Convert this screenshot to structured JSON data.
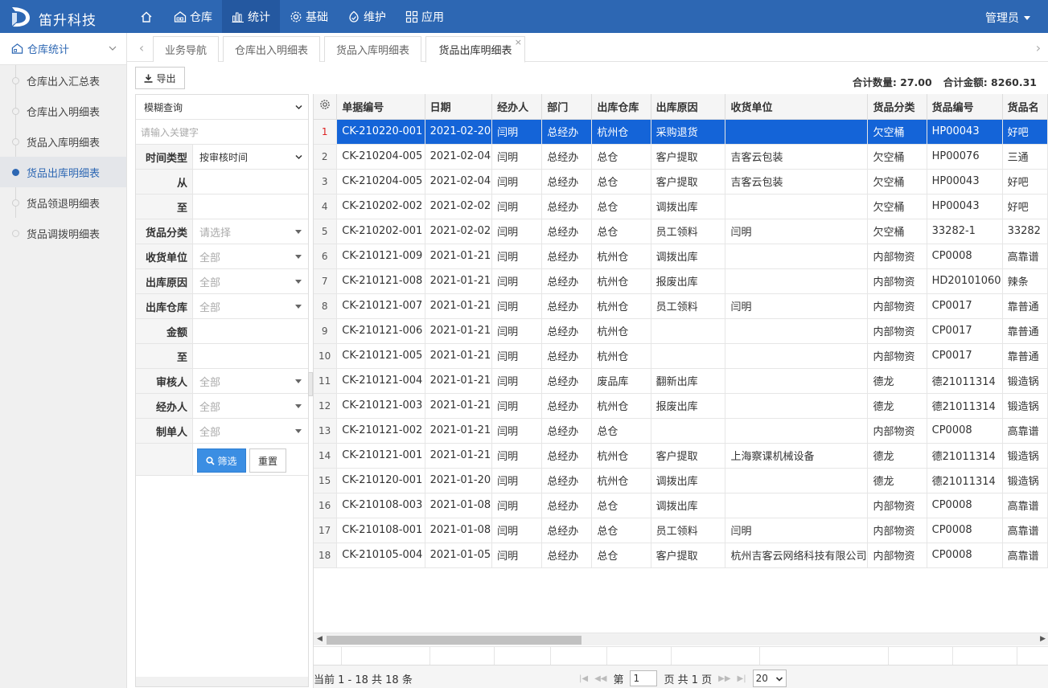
{
  "app": {
    "brand": "笛升科技",
    "user": "管理员"
  },
  "nav": [
    {
      "label": "",
      "icon": "home-icon"
    },
    {
      "label": "仓库",
      "icon": "warehouse-icon"
    },
    {
      "label": "统计",
      "icon": "chart-icon"
    },
    {
      "label": "基础",
      "icon": "gear-icon"
    },
    {
      "label": "维护",
      "icon": "maintenance-icon"
    },
    {
      "label": "应用",
      "icon": "apps-icon"
    }
  ],
  "sidebar": {
    "header": "仓库统计",
    "items": [
      "仓库出入汇总表",
      "仓库出入明细表",
      "货品入库明细表",
      "货品出库明细表",
      "货品领退明细表",
      "货品调拨明细表"
    ],
    "active_index": 3
  },
  "tabs": [
    "业务导航",
    "仓库出入明细表",
    "货品入库明细表",
    "货品出库明细表"
  ],
  "toolbar": {
    "export_label": "导出",
    "total_qty": "合计数量: 27.00",
    "total_amount": "合计金额: 8260.31"
  },
  "filter": {
    "search_mode": "模糊查询",
    "keyword_placeholder": "请输入关键字",
    "time_type_label": "时间类型",
    "time_type_value": "按审核时间",
    "from_label": "从",
    "to_label": "至",
    "category_label": "货品分类",
    "category_value": "请选择",
    "receiver_label": "收货单位",
    "receiver_value": "全部",
    "reason_label": "出库原因",
    "reason_value": "全部",
    "warehouse_label": "出库仓库",
    "warehouse_value": "全部",
    "amount_label": "金额",
    "amount_to_label": "至",
    "auditor_label": "审核人",
    "auditor_value": "全部",
    "handler_label": "经办人",
    "handler_value": "全部",
    "maker_label": "制单人",
    "maker_value": "全部",
    "filter_button": "筛选",
    "reset_button": "重置"
  },
  "table": {
    "columns": [
      "单据编号",
      "日期",
      "经办人",
      "部门",
      "出库仓库",
      "出库原因",
      "收货单位",
      "货品分类",
      "货品编号",
      "货品名"
    ],
    "rows": [
      [
        "CK-210220-001",
        "2021-02-20",
        "闫明",
        "总经办",
        "杭州仓",
        "采购退货",
        "",
        "欠空桶",
        "HP00043",
        "好吧"
      ],
      [
        "CK-210204-005",
        "2021-02-04",
        "闫明",
        "总经办",
        "总仓",
        "客户提取",
        "吉客云包装",
        "欠空桶",
        "HP00076",
        "三通"
      ],
      [
        "CK-210204-005",
        "2021-02-04",
        "闫明",
        "总经办",
        "总仓",
        "客户提取",
        "吉客云包装",
        "欠空桶",
        "HP00043",
        "好吧"
      ],
      [
        "CK-210202-002",
        "2021-02-02",
        "闫明",
        "总经办",
        "总仓",
        "调拨出库",
        "",
        "欠空桶",
        "HP00043",
        "好吧"
      ],
      [
        "CK-210202-001",
        "2021-02-02",
        "闫明",
        "总经办",
        "总仓",
        "员工领料",
        "闫明",
        "欠空桶",
        "33282-1",
        "33282"
      ],
      [
        "CK-210121-009",
        "2021-01-21",
        "闫明",
        "总经办",
        "杭州仓",
        "调拨出库",
        "",
        "内部物资",
        "CP0008",
        "高靠谱"
      ],
      [
        "CK-210121-008",
        "2021-01-21",
        "闫明",
        "总经办",
        "杭州仓",
        "报废出库",
        "",
        "内部物资",
        "HD20101060",
        "辣条"
      ],
      [
        "CK-210121-007",
        "2021-01-21",
        "闫明",
        "总经办",
        "杭州仓",
        "员工领料",
        "闫明",
        "内部物资",
        "CP0017",
        "靠普通"
      ],
      [
        "CK-210121-006",
        "2021-01-21",
        "闫明",
        "总经办",
        "杭州仓",
        "",
        "",
        "内部物资",
        "CP0017",
        "靠普通"
      ],
      [
        "CK-210121-005",
        "2021-01-21",
        "闫明",
        "总经办",
        "杭州仓",
        "",
        "",
        "内部物资",
        "CP0017",
        "靠普通"
      ],
      [
        "CK-210121-004",
        "2021-01-21",
        "闫明",
        "总经办",
        "废品库",
        "翻新出库",
        "",
        "德龙",
        "德21011314",
        "锻造锅"
      ],
      [
        "CK-210121-003",
        "2021-01-21",
        "闫明",
        "总经办",
        "杭州仓",
        "报废出库",
        "",
        "德龙",
        "德21011314",
        "锻造锅"
      ],
      [
        "CK-210121-002",
        "2021-01-21",
        "闫明",
        "总经办",
        "总仓",
        "",
        "",
        "内部物资",
        "CP0008",
        "高靠谱"
      ],
      [
        "CK-210121-001",
        "2021-01-21",
        "闫明",
        "总经办",
        "杭州仓",
        "客户提取",
        "上海察课机械设备",
        "德龙",
        "德21011314",
        "锻造锅"
      ],
      [
        "CK-210120-001",
        "2021-01-20",
        "闫明",
        "总经办",
        "杭州仓",
        "调拨出库",
        "",
        "德龙",
        "德21011314",
        "锻造锅"
      ],
      [
        "CK-210108-003",
        "2021-01-08",
        "闫明",
        "总经办",
        "总仓",
        "调拨出库",
        "",
        "内部物资",
        "CP0008",
        "高靠谱"
      ],
      [
        "CK-210108-001",
        "2021-01-08",
        "闫明",
        "总经办",
        "总仓",
        "员工领料",
        "闫明",
        "内部物资",
        "CP0008",
        "高靠谱"
      ],
      [
        "CK-210105-004",
        "2021-01-05",
        "闫明",
        "总经办",
        "总仓",
        "客户提取",
        "杭州吉客云网络科技有限公司",
        "内部物资",
        "CP0008",
        "高靠谱"
      ]
    ],
    "selected_index": 0
  },
  "pager": {
    "info": "当前 1 - 18 共 18 条",
    "page_prefix": "第",
    "page_value": "1",
    "page_suffix": "页 共 1 页",
    "page_size": "20"
  },
  "colors": {
    "primary": "#2d67b3",
    "selected_row": "#1464d8",
    "button_blue": "#3b8ee3"
  }
}
